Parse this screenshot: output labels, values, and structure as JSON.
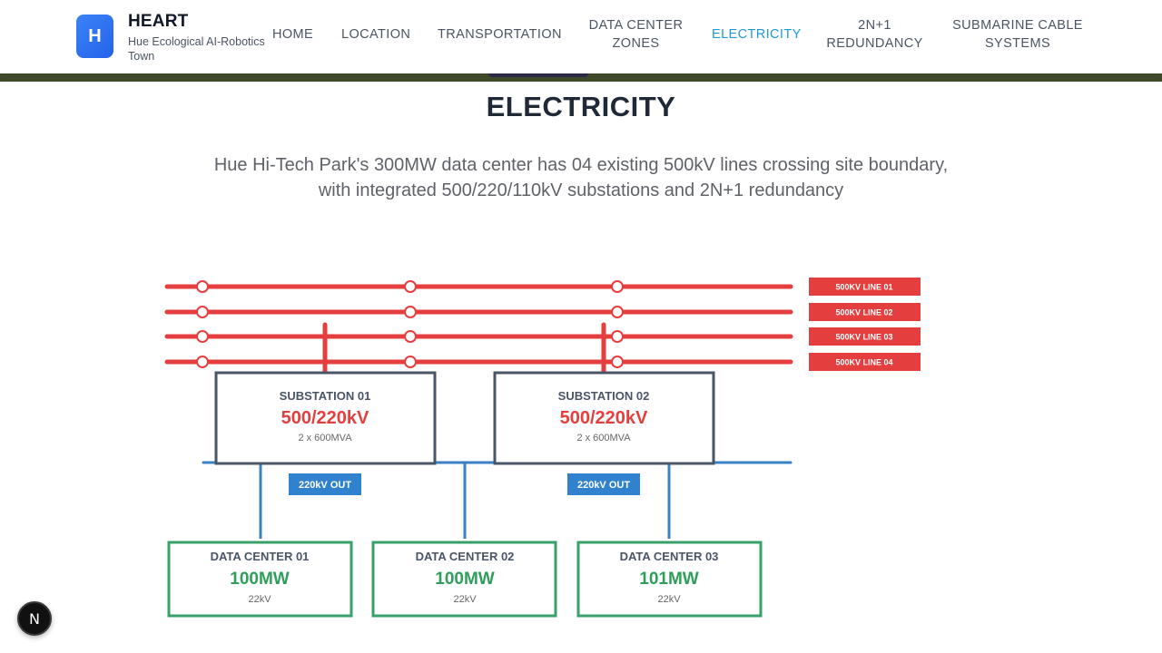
{
  "brand": {
    "logo_letter": "H",
    "title": "HEART",
    "subtitle": "Hue Ecological AI-Robotics Town"
  },
  "nav": {
    "home": "HOME",
    "location": "LOCATION",
    "transportation": "TRANSPORTATION",
    "dc_zones_l1": "DATA CENTER",
    "dc_zones_l2": "ZONES",
    "electricity": "ELECTRICITY",
    "redundancy_l1": "2N+1",
    "redundancy_l2": "REDUNDANCY",
    "submarine_l1": "SUBMARINE CABLE",
    "submarine_l2": "SYSTEMS",
    "active": "ELECTRICITY"
  },
  "section": {
    "title": "ELECTRICITY",
    "description_l1": "Hue Hi-Tech Park's 300MW data center has 04 existing 500kV lines crossing site boundary,",
    "description_l2": "with integrated 500/220/110kV substations and 2N+1 redundancy"
  },
  "diagram": {
    "lines": [
      "500KV LINE 01",
      "500KV LINE 02",
      "500KV LINE 03",
      "500KV LINE 04"
    ],
    "substations": [
      {
        "name": "SUBSTATION 01",
        "voltage": "500/220kV",
        "capacity": "2 x 600MVA",
        "out_label": "220kV OUT"
      },
      {
        "name": "SUBSTATION 02",
        "voltage": "500/220kV",
        "capacity": "2 x 600MVA",
        "out_label": "220kV OUT"
      }
    ],
    "data_centers": [
      {
        "name": "DATA CENTER 01",
        "power": "100MW",
        "voltage": "22kV"
      },
      {
        "name": "DATA CENTER 02",
        "power": "100MW",
        "voltage": "22kV"
      },
      {
        "name": "DATA CENTER 03",
        "power": "101MW",
        "voltage": "22kV"
      }
    ],
    "colors": {
      "hv_line": "#e53e3e",
      "bus": "#3b82c4",
      "substation_border": "#4a5568",
      "dc_border": "#38a169",
      "dc_power": "#2f9e5b",
      "label_bg": "#3182ce"
    }
  },
  "fab": {
    "icon": "N"
  }
}
